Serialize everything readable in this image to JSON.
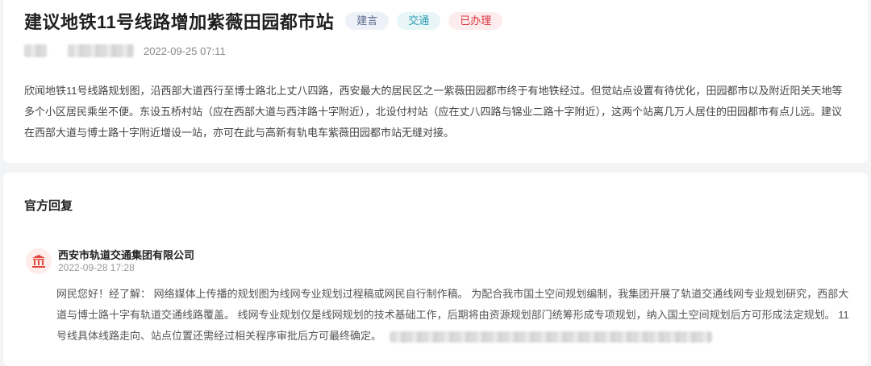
{
  "post": {
    "title": "建议地铁11号线路增加紫薇田园都市站",
    "tags": [
      "建言",
      "交通",
      "已办理"
    ],
    "time": "2022-09-25 07:11",
    "content": "欣闻地铁11号线路规划图，沿西部大道西行至博士路北上丈八四路，西安最大的居民区之一紫薇田园都市终于有地铁经过。但觉站点设置有待优化，田园都市以及附近阳关天地等多个小区居民乘坐不便。东设五桥村站（应在西部大道与西沣路十字附近），北设付村站（应在丈八四路与锦业二路十字附近），这两个站离几万人居住的田园都市有点儿远。建议在西部大道与博士路十字附近增设一站，亦可在此与高新有轨电车紫薇田园都市站无缝对接。"
  },
  "reply": {
    "section_title": "官方回复",
    "org_name": "西安市轨道交通集团有限公司",
    "time": "2022-09-28 17:28",
    "content": "网民您好！经了解： 网络媒体上传播的规划图为线网专业规划过程稿或网民自行制作稿。 为配合我市国土空间规划编制，我集团开展了轨道交通线网专业规划研究，西部大道与博士路十字有轨道交通线路覆盖。 线网专业规划仅是线网规划的技术基础工作，后期将由资源规划部门统筹形成专项规划，纳入国土空间规划后方可形成法定规划。 11号线具体线路走向、站点位置还需经过相关程序审批后方可最终确定。"
  },
  "colors": {
    "tag_suggest": "#5a6b8c",
    "tag_traffic": "#2b9fb3",
    "tag_done": "#d9363e",
    "org_icon": "#e0453a"
  },
  "icons": {
    "org": "government-building-icon"
  }
}
